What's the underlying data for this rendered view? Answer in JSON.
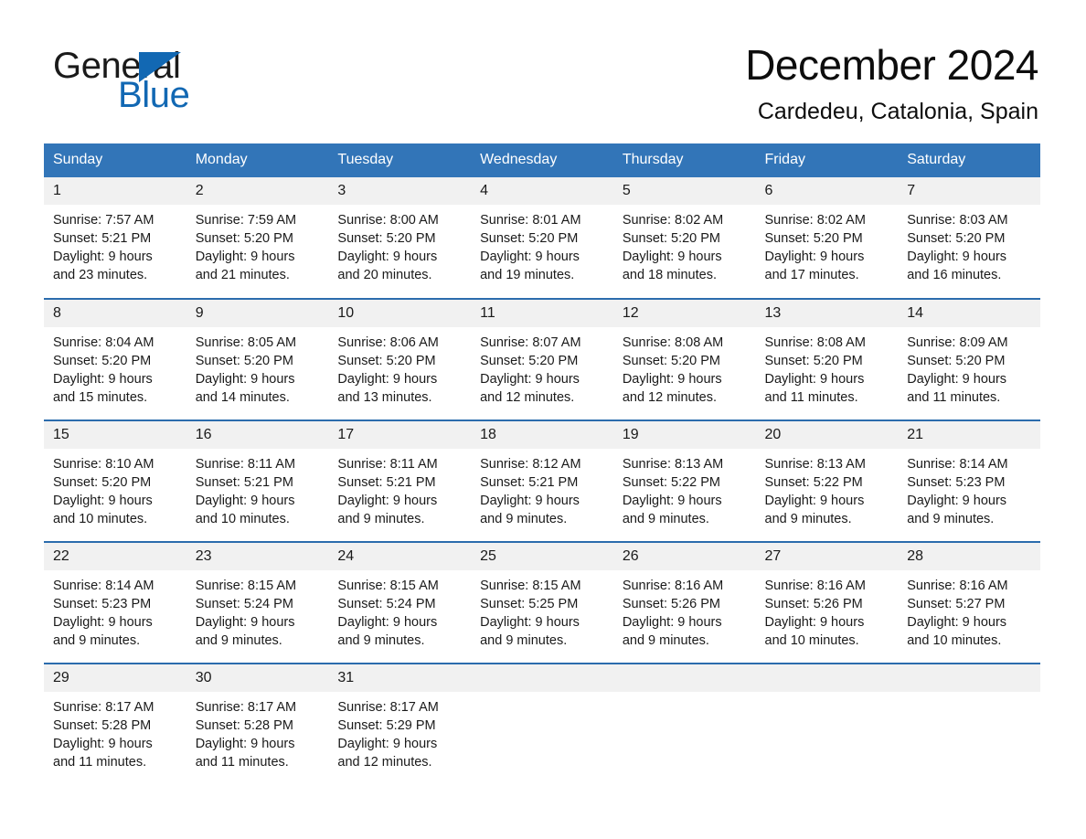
{
  "brand": {
    "name_part1": "General",
    "name_part2": "Blue",
    "color_black": "#1a1a1a",
    "color_blue": "#1268b3"
  },
  "header": {
    "title": "December 2024",
    "location": "Cardedeu, Catalonia, Spain"
  },
  "theme": {
    "header_blue": "#3275b8",
    "row_rule_blue": "#2b6cad",
    "day_band_gray": "#f1f1f1"
  },
  "weekday_headers": [
    "Sunday",
    "Monday",
    "Tuesday",
    "Wednesday",
    "Thursday",
    "Friday",
    "Saturday"
  ],
  "weeks": [
    [
      {
        "day": "1",
        "sunrise": "Sunrise: 7:57 AM",
        "sunset": "Sunset: 5:21 PM",
        "daylight_line1": "Daylight: 9 hours",
        "daylight_line2": "and 23 minutes."
      },
      {
        "day": "2",
        "sunrise": "Sunrise: 7:59 AM",
        "sunset": "Sunset: 5:20 PM",
        "daylight_line1": "Daylight: 9 hours",
        "daylight_line2": "and 21 minutes."
      },
      {
        "day": "3",
        "sunrise": "Sunrise: 8:00 AM",
        "sunset": "Sunset: 5:20 PM",
        "daylight_line1": "Daylight: 9 hours",
        "daylight_line2": "and 20 minutes."
      },
      {
        "day": "4",
        "sunrise": "Sunrise: 8:01 AM",
        "sunset": "Sunset: 5:20 PM",
        "daylight_line1": "Daylight: 9 hours",
        "daylight_line2": "and 19 minutes."
      },
      {
        "day": "5",
        "sunrise": "Sunrise: 8:02 AM",
        "sunset": "Sunset: 5:20 PM",
        "daylight_line1": "Daylight: 9 hours",
        "daylight_line2": "and 18 minutes."
      },
      {
        "day": "6",
        "sunrise": "Sunrise: 8:02 AM",
        "sunset": "Sunset: 5:20 PM",
        "daylight_line1": "Daylight: 9 hours",
        "daylight_line2": "and 17 minutes."
      },
      {
        "day": "7",
        "sunrise": "Sunrise: 8:03 AM",
        "sunset": "Sunset: 5:20 PM",
        "daylight_line1": "Daylight: 9 hours",
        "daylight_line2": "and 16 minutes."
      }
    ],
    [
      {
        "day": "8",
        "sunrise": "Sunrise: 8:04 AM",
        "sunset": "Sunset: 5:20 PM",
        "daylight_line1": "Daylight: 9 hours",
        "daylight_line2": "and 15 minutes."
      },
      {
        "day": "9",
        "sunrise": "Sunrise: 8:05 AM",
        "sunset": "Sunset: 5:20 PM",
        "daylight_line1": "Daylight: 9 hours",
        "daylight_line2": "and 14 minutes."
      },
      {
        "day": "10",
        "sunrise": "Sunrise: 8:06 AM",
        "sunset": "Sunset: 5:20 PM",
        "daylight_line1": "Daylight: 9 hours",
        "daylight_line2": "and 13 minutes."
      },
      {
        "day": "11",
        "sunrise": "Sunrise: 8:07 AM",
        "sunset": "Sunset: 5:20 PM",
        "daylight_line1": "Daylight: 9 hours",
        "daylight_line2": "and 12 minutes."
      },
      {
        "day": "12",
        "sunrise": "Sunrise: 8:08 AM",
        "sunset": "Sunset: 5:20 PM",
        "daylight_line1": "Daylight: 9 hours",
        "daylight_line2": "and 12 minutes."
      },
      {
        "day": "13",
        "sunrise": "Sunrise: 8:08 AM",
        "sunset": "Sunset: 5:20 PM",
        "daylight_line1": "Daylight: 9 hours",
        "daylight_line2": "and 11 minutes."
      },
      {
        "day": "14",
        "sunrise": "Sunrise: 8:09 AM",
        "sunset": "Sunset: 5:20 PM",
        "daylight_line1": "Daylight: 9 hours",
        "daylight_line2": "and 11 minutes."
      }
    ],
    [
      {
        "day": "15",
        "sunrise": "Sunrise: 8:10 AM",
        "sunset": "Sunset: 5:20 PM",
        "daylight_line1": "Daylight: 9 hours",
        "daylight_line2": "and 10 minutes."
      },
      {
        "day": "16",
        "sunrise": "Sunrise: 8:11 AM",
        "sunset": "Sunset: 5:21 PM",
        "daylight_line1": "Daylight: 9 hours",
        "daylight_line2": "and 10 minutes."
      },
      {
        "day": "17",
        "sunrise": "Sunrise: 8:11 AM",
        "sunset": "Sunset: 5:21 PM",
        "daylight_line1": "Daylight: 9 hours",
        "daylight_line2": "and 9 minutes."
      },
      {
        "day": "18",
        "sunrise": "Sunrise: 8:12 AM",
        "sunset": "Sunset: 5:21 PM",
        "daylight_line1": "Daylight: 9 hours",
        "daylight_line2": "and 9 minutes."
      },
      {
        "day": "19",
        "sunrise": "Sunrise: 8:13 AM",
        "sunset": "Sunset: 5:22 PM",
        "daylight_line1": "Daylight: 9 hours",
        "daylight_line2": "and 9 minutes."
      },
      {
        "day": "20",
        "sunrise": "Sunrise: 8:13 AM",
        "sunset": "Sunset: 5:22 PM",
        "daylight_line1": "Daylight: 9 hours",
        "daylight_line2": "and 9 minutes."
      },
      {
        "day": "21",
        "sunrise": "Sunrise: 8:14 AM",
        "sunset": "Sunset: 5:23 PM",
        "daylight_line1": "Daylight: 9 hours",
        "daylight_line2": "and 9 minutes."
      }
    ],
    [
      {
        "day": "22",
        "sunrise": "Sunrise: 8:14 AM",
        "sunset": "Sunset: 5:23 PM",
        "daylight_line1": "Daylight: 9 hours",
        "daylight_line2": "and 9 minutes."
      },
      {
        "day": "23",
        "sunrise": "Sunrise: 8:15 AM",
        "sunset": "Sunset: 5:24 PM",
        "daylight_line1": "Daylight: 9 hours",
        "daylight_line2": "and 9 minutes."
      },
      {
        "day": "24",
        "sunrise": "Sunrise: 8:15 AM",
        "sunset": "Sunset: 5:24 PM",
        "daylight_line1": "Daylight: 9 hours",
        "daylight_line2": "and 9 minutes."
      },
      {
        "day": "25",
        "sunrise": "Sunrise: 8:15 AM",
        "sunset": "Sunset: 5:25 PM",
        "daylight_line1": "Daylight: 9 hours",
        "daylight_line2": "and 9 minutes."
      },
      {
        "day": "26",
        "sunrise": "Sunrise: 8:16 AM",
        "sunset": "Sunset: 5:26 PM",
        "daylight_line1": "Daylight: 9 hours",
        "daylight_line2": "and 9 minutes."
      },
      {
        "day": "27",
        "sunrise": "Sunrise: 8:16 AM",
        "sunset": "Sunset: 5:26 PM",
        "daylight_line1": "Daylight: 9 hours",
        "daylight_line2": "and 10 minutes."
      },
      {
        "day": "28",
        "sunrise": "Sunrise: 8:16 AM",
        "sunset": "Sunset: 5:27 PM",
        "daylight_line1": "Daylight: 9 hours",
        "daylight_line2": "and 10 minutes."
      }
    ],
    [
      {
        "day": "29",
        "sunrise": "Sunrise: 8:17 AM",
        "sunset": "Sunset: 5:28 PM",
        "daylight_line1": "Daylight: 9 hours",
        "daylight_line2": "and 11 minutes."
      },
      {
        "day": "30",
        "sunrise": "Sunrise: 8:17 AM",
        "sunset": "Sunset: 5:28 PM",
        "daylight_line1": "Daylight: 9 hours",
        "daylight_line2": "and 11 minutes."
      },
      {
        "day": "31",
        "sunrise": "Sunrise: 8:17 AM",
        "sunset": "Sunset: 5:29 PM",
        "daylight_line1": "Daylight: 9 hours",
        "daylight_line2": "and 12 minutes."
      },
      {
        "day": "",
        "sunrise": "",
        "sunset": "",
        "daylight_line1": "",
        "daylight_line2": ""
      },
      {
        "day": "",
        "sunrise": "",
        "sunset": "",
        "daylight_line1": "",
        "daylight_line2": ""
      },
      {
        "day": "",
        "sunrise": "",
        "sunset": "",
        "daylight_line1": "",
        "daylight_line2": ""
      },
      {
        "day": "",
        "sunrise": "",
        "sunset": "",
        "daylight_line1": "",
        "daylight_line2": ""
      }
    ]
  ]
}
